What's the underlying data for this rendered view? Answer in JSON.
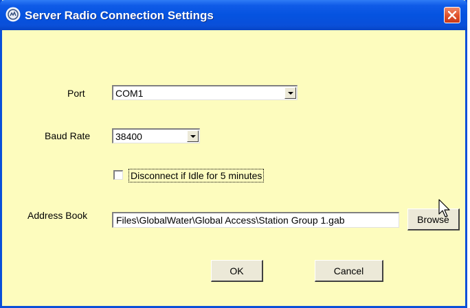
{
  "window": {
    "title": "Server Radio Connection Settings",
    "icon": "radio-icon",
    "close_icon": "close-icon"
  },
  "form": {
    "port_label": "Port",
    "port_value": "COM1",
    "baud_label": "Baud Rate",
    "baud_value": "38400",
    "idle_checkbox_label": "Disconnect if Idle for 5 minutes",
    "idle_checked": false,
    "address_book_label": "Address Book",
    "address_book_value": "Files\\GlobalWater\\Global Access\\Station Group 1.gab",
    "browse_label": "Browse"
  },
  "buttons": {
    "ok_label": "OK",
    "cancel_label": "Cancel"
  },
  "colors": {
    "dialog_background": "#fdfcbe",
    "titlebar": "#0553e0",
    "close_button": "#e0512b",
    "button_face": "#ece9d8"
  }
}
